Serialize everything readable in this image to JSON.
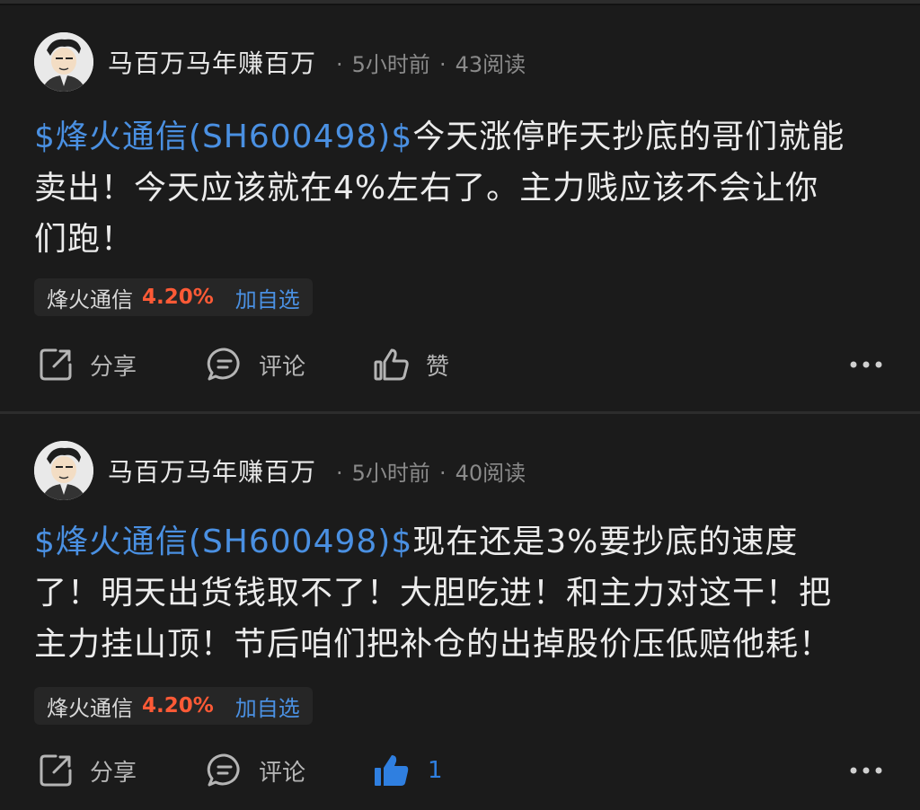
{
  "posts": [
    {
      "author": "马百万马年赚百万",
      "time": "5小时前",
      "reads": "43阅读",
      "stock_tag": "$烽火通信(SH600498)$",
      "text_lines": [
        "今天涨停昨天抄底的哥们就能",
        "卖出！今天应该就在4%左右了。主力贱应该不会让你",
        "们跑！"
      ],
      "chip": {
        "name": "烽火通信",
        "change": "4.20%",
        "add": "加自选"
      },
      "actions": {
        "share": "分享",
        "comment": "评论",
        "like": "赞"
      },
      "liked": false
    },
    {
      "author": "马百万马年赚百万",
      "time": "5小时前",
      "reads": "40阅读",
      "stock_tag": "$烽火通信(SH600498)$",
      "text_lines": [
        "现在还是3%要抄底的速度",
        "了！明天出货钱取不了！大胆吃进！和主力对这干！把",
        "主力挂山顶！节后咱们把补仓的出掉股价压低赔他耗！"
      ],
      "chip": {
        "name": "烽火通信",
        "change": "4.20%",
        "add": "加自选"
      },
      "actions": {
        "share": "分享",
        "comment": "评论",
        "like": "1"
      },
      "liked": true
    }
  ],
  "colors": {
    "background": "#121212",
    "card": "#1b1b1b",
    "link": "#4a90e2",
    "up": "#ff5a36",
    "liked": "#2f7fe0"
  },
  "icons": [
    "avatar",
    "share-icon",
    "comment-icon",
    "thumbs-up-icon",
    "more-icon"
  ]
}
